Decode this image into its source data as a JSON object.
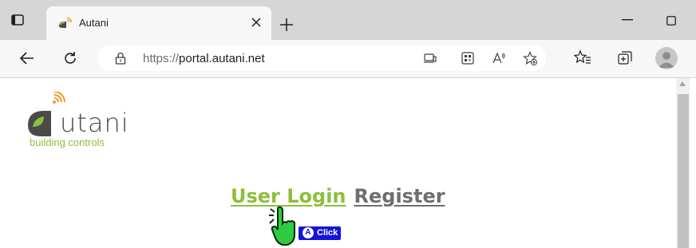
{
  "tab": {
    "title": "Autani"
  },
  "address_bar": {
    "url_scheme": "https://",
    "url_host": "portal.autani.net"
  },
  "page": {
    "logo": {
      "wordmark": "utani",
      "tagline": "building controls"
    },
    "links": {
      "login": "User Login",
      "register": "Register"
    }
  },
  "overlay": {
    "key": "A",
    "action": "Click"
  },
  "colors": {
    "brand_green": "#8dbf3b",
    "brand_orange": "#f39a2b",
    "link_gray": "#6e6e6e",
    "badge_blue": "#1414d8"
  }
}
